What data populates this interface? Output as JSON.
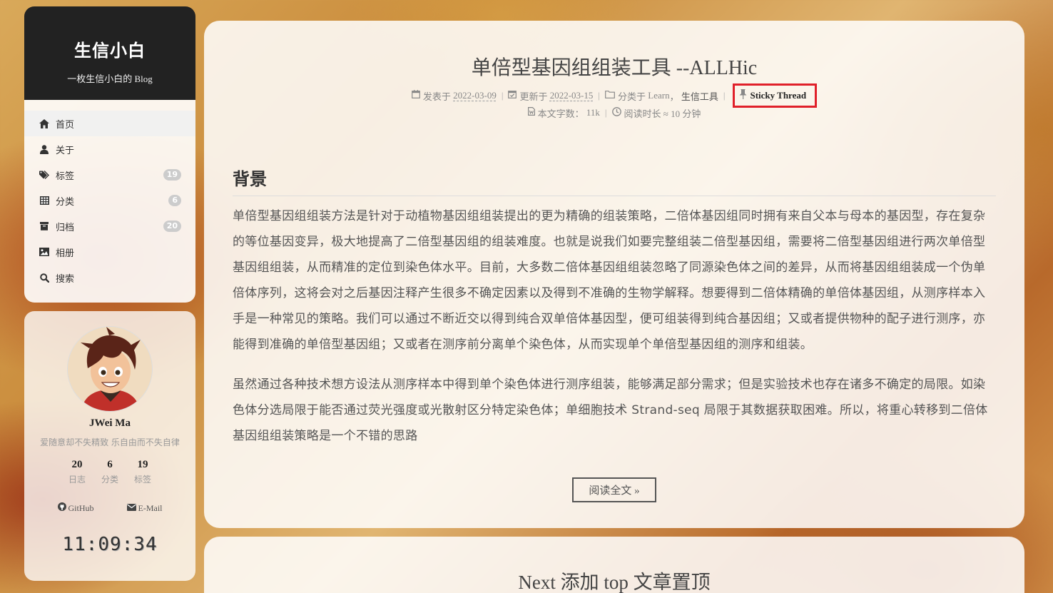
{
  "site": {
    "title": "生信小白",
    "subtitle": "一枚生信小白的 Blog"
  },
  "menu": [
    {
      "label": "首页",
      "icon": "home-icon",
      "badge": ""
    },
    {
      "label": "关于",
      "icon": "user-icon",
      "badge": ""
    },
    {
      "label": "标签",
      "icon": "tags-icon",
      "badge": "19"
    },
    {
      "label": "分类",
      "icon": "grid-icon",
      "badge": "6"
    },
    {
      "label": "归档",
      "icon": "archive-icon",
      "badge": "20"
    },
    {
      "label": "相册",
      "icon": "image-icon",
      "badge": ""
    },
    {
      "label": "搜索",
      "icon": "search-icon",
      "badge": ""
    }
  ],
  "author": {
    "name": "JWei Ma",
    "motto": "爱随意却不失精致 乐自由而不失自律",
    "stats": [
      {
        "count": "20",
        "label": "日志"
      },
      {
        "count": "6",
        "label": "分类"
      },
      {
        "count": "19",
        "label": "标签"
      }
    ],
    "links": [
      {
        "label": "GitHub",
        "icon": "github-icon"
      },
      {
        "label": "E-Mail",
        "icon": "envelope-icon"
      }
    ],
    "clock": "11:09:34"
  },
  "post": {
    "title": "单倍型基因组组装工具 --ALLHic",
    "meta": {
      "posted_label": "发表于",
      "posted_date": "2022-03-09",
      "updated_label": "更新于",
      "updated_date": "2022-03-15",
      "category_label": "分类于",
      "category_1": "Learn",
      "category_sep": "，",
      "category_2": "生信工具",
      "sticky": "Sticky Thread",
      "wordcount_label": "本文字数：",
      "wordcount": "11k",
      "readtime_label": "阅读时长 ≈",
      "readtime": "10 分钟"
    },
    "section_title": "背景",
    "paragraphs": [
      "单倍型基因组组装方法是针对于动植物基因组组装提出的更为精确的组装策略，二倍体基因组同时拥有来自父本与母本的基因型，存在复杂的等位基因变异，极大地提高了二倍型基因组的组装难度。也就是说我们如要完整组装二倍型基因组，需要将二倍型基因组进行两次单倍型基因组组装，从而精准的定位到染色体水平。目前，大多数二倍体基因组组装忽略了同源染色体之间的差异，从而将基因组组装成一个伪单倍体序列，这将会对之后基因注释产生很多不确定因素以及得到不准确的生物学解释。想要得到二倍体精确的单倍体基因组，从测序样本入手是一种常见的策略。我们可以通过不断近交以得到纯合双单倍体基因型，便可组装得到纯合基因组；又或者提供物种的配子进行测序，亦能得到准确的单倍型基因组；又或者在测序前分离单个染色体，从而实现单个单倍型基因组的测序和组装。",
      "虽然通过各种技术想方设法从测序样本中得到单个染色体进行测序组装，能够满足部分需求；但是实验技术也存在诸多不确定的局限。如染色体分选局限于能否通过荧光强度或光散射区分特定染色体；单细胞技术 Strand-seq 局限于其数据获取困难。所以，将重心转移到二倍体基因组组装策略是一个不错的思路"
    ],
    "read_more": "阅读全文 »"
  },
  "next_post": {
    "title": "Next 添加 top 文章置顶"
  }
}
